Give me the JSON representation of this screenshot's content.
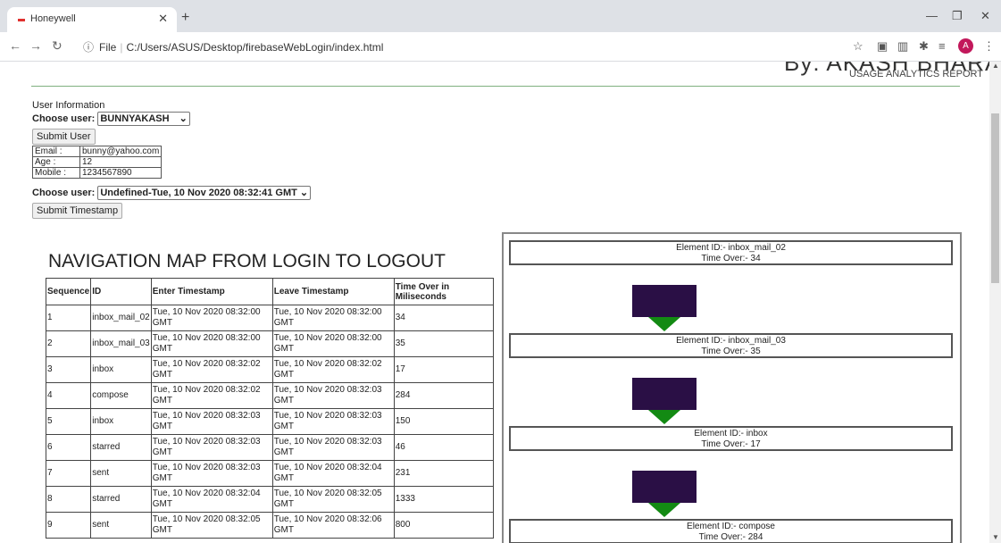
{
  "browser": {
    "tab_title": "Honeywell",
    "url_prefix": "File",
    "url": "C:/Users/ASUS/Desktop/firebaseWebLogin/index.html",
    "avatar_letter": "A"
  },
  "header": {
    "byline": "By: AKASH BHARAT",
    "report_title": "USAGE ANALYTICS REPORT"
  },
  "user_section": {
    "heading": "User Information",
    "choose_label": "Choose user:",
    "selected_user": "BUNNYAKASH",
    "submit_user_label": "Submit User",
    "details": [
      {
        "label": "Email :",
        "value": "bunny@yahoo.com"
      },
      {
        "label": "Age :",
        "value": "12"
      },
      {
        "label": "Mobile :",
        "value": "1234567890"
      }
    ],
    "timestamp_choose_label": "Choose user:",
    "selected_timestamp": "Undefined-Tue, 10 Nov 2020 08:32:41 GMT",
    "submit_timestamp_label": "Submit Timestamp"
  },
  "nav_map": {
    "title": "NAVIGATION MAP FROM LOGIN TO LOGOUT",
    "columns": [
      "Sequence",
      "ID",
      "Enter Timestamp",
      "Leave Timestamp",
      "Time Over in Miliseconds"
    ],
    "rows": [
      [
        "1",
        "inbox_mail_02",
        "Tue, 10 Nov 2020 08:32:00 GMT",
        "Tue, 10 Nov 2020 08:32:00 GMT",
        "34"
      ],
      [
        "2",
        "inbox_mail_03",
        "Tue, 10 Nov 2020 08:32:00 GMT",
        "Tue, 10 Nov 2020 08:32:00 GMT",
        "35"
      ],
      [
        "3",
        "inbox",
        "Tue, 10 Nov 2020 08:32:02 GMT",
        "Tue, 10 Nov 2020 08:32:02 GMT",
        "17"
      ],
      [
        "4",
        "compose",
        "Tue, 10 Nov 2020 08:32:02 GMT",
        "Tue, 10 Nov 2020 08:32:03 GMT",
        "284"
      ],
      [
        "5",
        "inbox",
        "Tue, 10 Nov 2020 08:32:03 GMT",
        "Tue, 10 Nov 2020 08:32:03 GMT",
        "150"
      ],
      [
        "6",
        "starred",
        "Tue, 10 Nov 2020 08:32:03 GMT",
        "Tue, 10 Nov 2020 08:32:03 GMT",
        "46"
      ],
      [
        "7",
        "sent",
        "Tue, 10 Nov 2020 08:32:03 GMT",
        "Tue, 10 Nov 2020 08:32:04 GMT",
        "231"
      ],
      [
        "8",
        "starred",
        "Tue, 10 Nov 2020 08:32:04 GMT",
        "Tue, 10 Nov 2020 08:32:05 GMT",
        "1333"
      ],
      [
        "9",
        "sent",
        "Tue, 10 Nov 2020 08:32:05 GMT",
        "Tue, 10 Nov 2020 08:32:06 GMT",
        "800"
      ]
    ]
  },
  "flow": {
    "nodes": [
      {
        "id_line": "Element ID:- inbox_mail_02",
        "time_line": "Time Over:- 34"
      },
      {
        "id_line": "Element ID:- inbox_mail_03",
        "time_line": "Time Over:- 35"
      },
      {
        "id_line": "Element ID:- inbox",
        "time_line": "Time Over:- 17"
      },
      {
        "id_line": "Element ID:- compose",
        "time_line": "Time Over:- 284"
      }
    ],
    "bar_color": "#2a0f45",
    "arrow_color": "#138a13"
  }
}
